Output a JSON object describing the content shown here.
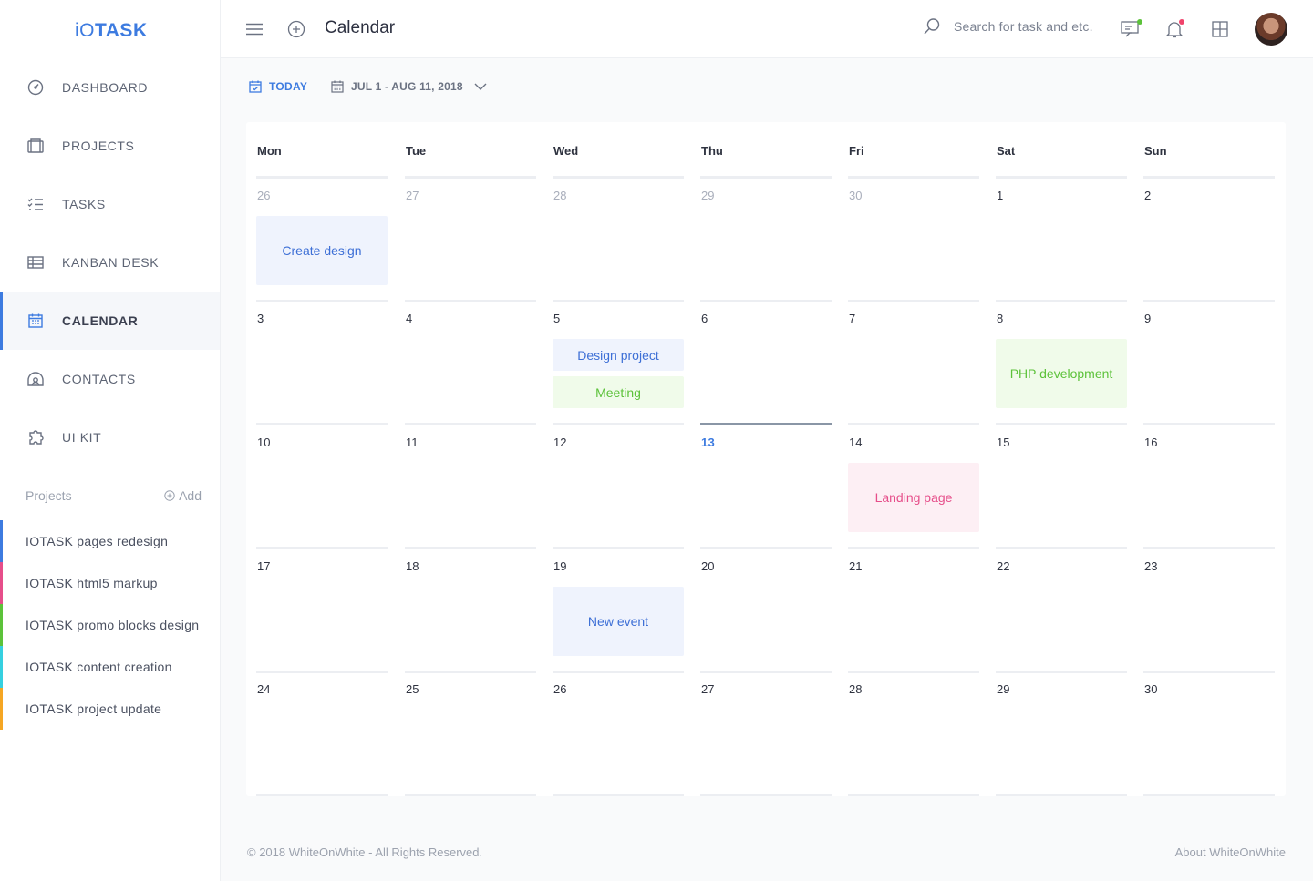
{
  "brand": {
    "logo_light": "iO",
    "logo_bold": "TASK",
    "color": "#3d7be0"
  },
  "sidebar": {
    "items": [
      {
        "label": "DASHBOARD",
        "icon": "dashboard-gauge-icon"
      },
      {
        "label": "PROJECTS",
        "icon": "projects-icon"
      },
      {
        "label": "TASKS",
        "icon": "tasks-checklist-icon"
      },
      {
        "label": "KANBAN DESK",
        "icon": "kanban-table-icon"
      },
      {
        "label": "CALENDAR",
        "icon": "calendar-icon",
        "active": true
      },
      {
        "label": "CONTACTS",
        "icon": "contacts-icon"
      },
      {
        "label": "UI KIT",
        "icon": "puzzle-icon"
      }
    ],
    "projects_heading": "Projects",
    "add_label": "Add",
    "projects": [
      {
        "label": "IOTASK pages redesign",
        "color": "#3d7be0"
      },
      {
        "label": "IOTASK html5 markup",
        "color": "#e64e8a"
      },
      {
        "label": "IOTASK promo blocks design",
        "color": "#5cc23a"
      },
      {
        "label": "IOTASK content creation",
        "color": "#35d0e0"
      },
      {
        "label": "IOTASK project update",
        "color": "#f5a623"
      }
    ]
  },
  "header": {
    "title": "Calendar",
    "search_placeholder": "Search for task and etc."
  },
  "toolbar": {
    "today_label": "TODAY",
    "range_label": "JUL 1 - AUG 11, 2018"
  },
  "calendar": {
    "days_of_week": [
      "Mon",
      "Tue",
      "Wed",
      "Thu",
      "Fri",
      "Sat",
      "Sun"
    ],
    "weeks": [
      [
        {
          "day": "26",
          "muted": true,
          "events": [
            {
              "title": "Create design",
              "color": "blue"
            }
          ]
        },
        {
          "day": "27",
          "muted": true,
          "events": []
        },
        {
          "day": "28",
          "muted": true,
          "events": []
        },
        {
          "day": "29",
          "muted": true,
          "events": []
        },
        {
          "day": "30",
          "muted": true,
          "events": []
        },
        {
          "day": "1",
          "events": []
        },
        {
          "day": "2",
          "events": []
        }
      ],
      [
        {
          "day": "3",
          "events": []
        },
        {
          "day": "4",
          "events": []
        },
        {
          "day": "5",
          "events": [
            {
              "title": "Design project",
              "color": "blue",
              "size": "half"
            },
            {
              "title": "Meeting",
              "color": "green",
              "size": "half"
            }
          ]
        },
        {
          "day": "6",
          "events": [],
          "highlight_bottom": true
        },
        {
          "day": "7",
          "events": []
        },
        {
          "day": "8",
          "events": [
            {
              "title": "PHP development",
              "color": "green"
            }
          ]
        },
        {
          "day": "9",
          "events": []
        }
      ],
      [
        {
          "day": "10",
          "events": []
        },
        {
          "day": "11",
          "events": []
        },
        {
          "day": "12",
          "events": []
        },
        {
          "day": "13",
          "today": true,
          "events": []
        },
        {
          "day": "14",
          "events": [
            {
              "title": "Landing page",
              "color": "pink"
            }
          ]
        },
        {
          "day": "15",
          "events": []
        },
        {
          "day": "16",
          "events": []
        }
      ],
      [
        {
          "day": "17",
          "events": []
        },
        {
          "day": "18",
          "events": []
        },
        {
          "day": "19",
          "events": [
            {
              "title": "New event",
              "color": "blue"
            }
          ]
        },
        {
          "day": "20",
          "events": []
        },
        {
          "day": "21",
          "events": []
        },
        {
          "day": "22",
          "events": []
        },
        {
          "day": "23",
          "events": []
        }
      ],
      [
        {
          "day": "24",
          "events": []
        },
        {
          "day": "25",
          "events": []
        },
        {
          "day": "26",
          "events": []
        },
        {
          "day": "27",
          "events": []
        },
        {
          "day": "28",
          "events": []
        },
        {
          "day": "29",
          "events": []
        },
        {
          "day": "30",
          "events": []
        }
      ]
    ]
  },
  "footer": {
    "copyright": "© 2018 WhiteOnWhite - All Rights Reserved.",
    "about_link": "About WhiteOnWhite"
  }
}
